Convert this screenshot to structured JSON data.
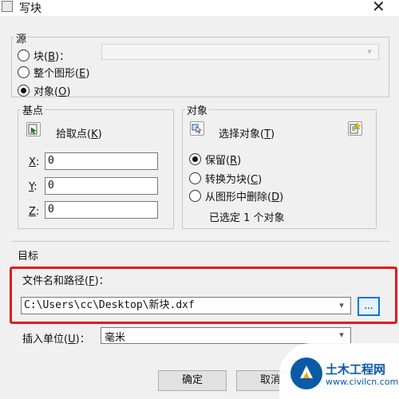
{
  "window": {
    "title": "写块",
    "close_glyph": "✕"
  },
  "source": {
    "label": "源",
    "options": [
      {
        "text": "块",
        "key": "B",
        "suffix": "：",
        "selected": false
      },
      {
        "text": "整个图形",
        "key": "E",
        "suffix": "",
        "selected": false
      },
      {
        "text": "对象",
        "key": "O",
        "suffix": "",
        "selected": true
      }
    ],
    "block_select_value": ""
  },
  "base_point": {
    "label": "基点",
    "pick_text": "拾取点",
    "pick_key": "K",
    "fields": [
      {
        "label": "X",
        "suffix": ":",
        "value": "0"
      },
      {
        "label": "Y",
        "suffix": ":",
        "value": "0"
      },
      {
        "label": "Z",
        "suffix": ":",
        "value": "0"
      }
    ]
  },
  "objects": {
    "label": "对象",
    "select_text": "选择对象",
    "select_key": "T",
    "options": [
      {
        "text": "保留",
        "key": "R",
        "selected": true
      },
      {
        "text": "转换为块",
        "key": "C",
        "selected": false
      },
      {
        "text": "从图形中删除",
        "key": "D",
        "selected": false
      }
    ],
    "status": "已选定 1 个对象"
  },
  "destination": {
    "label": "目标",
    "path_label_text": "文件名和路径",
    "path_label_key": "F",
    "path_label_suffix": "：",
    "path_value": "C:\\Users\\cc\\Desktop\\新块.dxf",
    "browse_label": "...",
    "units_label_text": "插入单位",
    "units_label_key": "U",
    "units_label_suffix": "：",
    "units_value": "毫米"
  },
  "buttons": {
    "ok": "确定",
    "cancel": "取消"
  },
  "watermark": {
    "name": "土木工程网",
    "url": "www.civilcn.com"
  },
  "colors": {
    "highlight": "#e21b1b",
    "accent": "#0078d7",
    "watermark": "#0b5aa6"
  }
}
